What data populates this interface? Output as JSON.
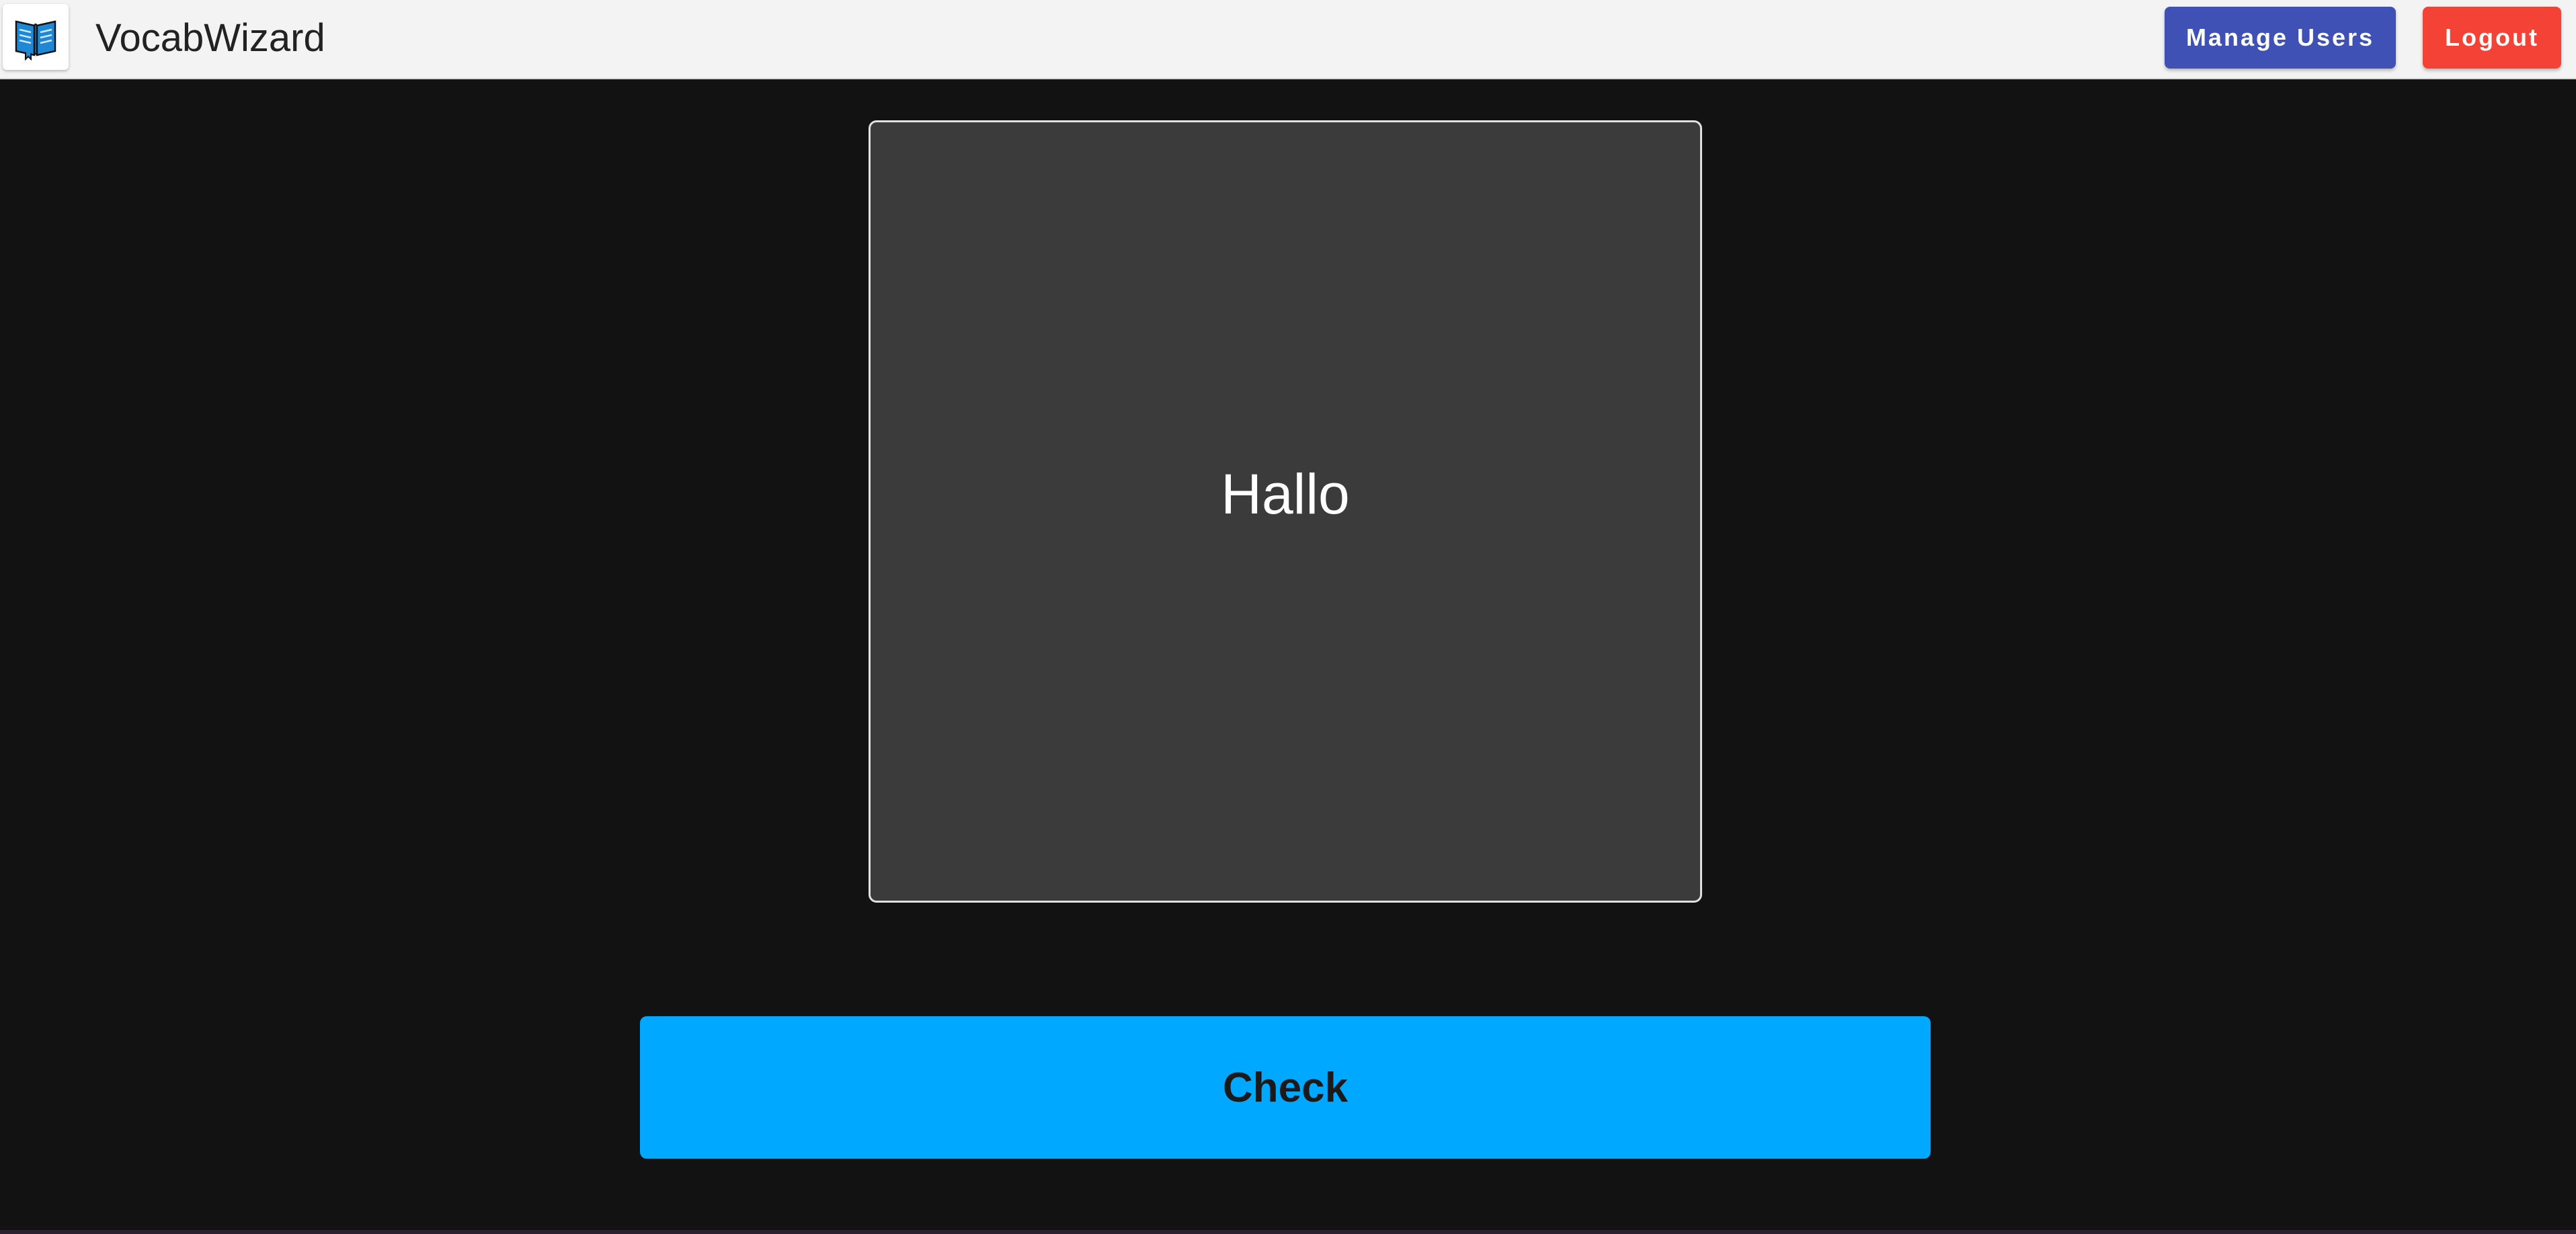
{
  "app": {
    "title": "VocabWizard",
    "logo_icon": "open-book-icon"
  },
  "header": {
    "manage_users_label": "Manage Users",
    "logout_label": "Logout"
  },
  "flashcard": {
    "word": "Hallo"
  },
  "actions": {
    "check_label": "Check"
  },
  "colors": {
    "appbar": "#f3f3f3",
    "background": "#121212",
    "manage_users": "#3f51b5",
    "logout": "#f44336",
    "card": "#3b3b3b",
    "check": "#00a8ff"
  }
}
